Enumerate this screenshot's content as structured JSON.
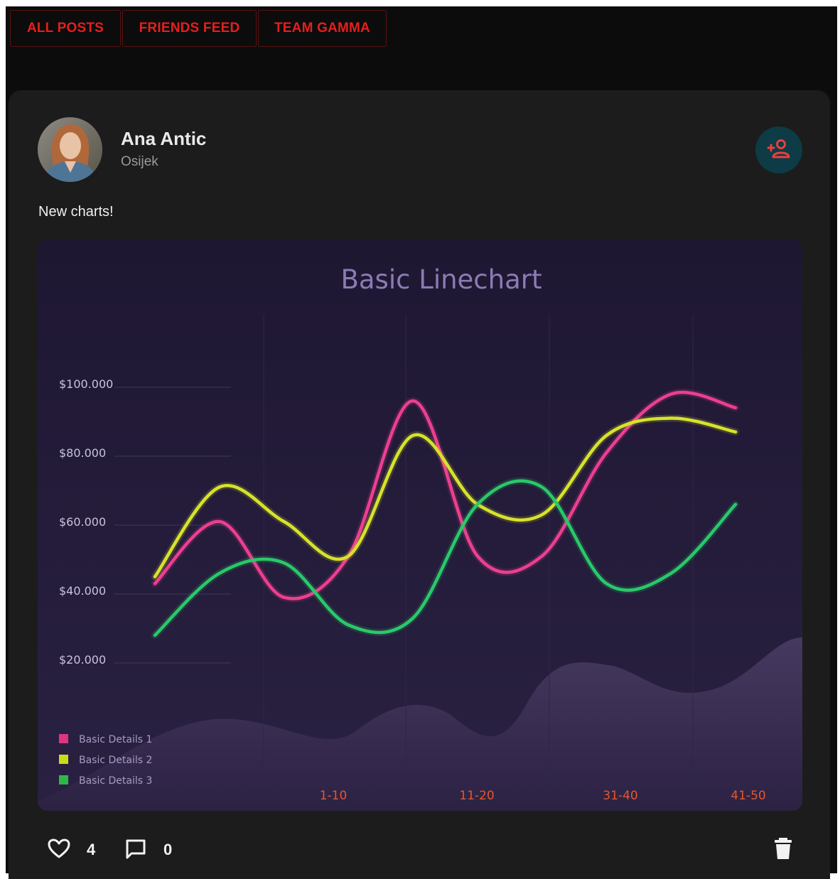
{
  "tabs": [
    "ALL POSTS",
    "FRIENDS FEED",
    "TEAM GAMMA"
  ],
  "post": {
    "author": "Ana Antic",
    "location": "Osijek",
    "text": "New charts!",
    "likes": "4",
    "comments": "0"
  },
  "icons": {
    "follow": "add-user-icon",
    "like": "heart-icon",
    "comment": "comment-icon",
    "delete": "trash-icon"
  },
  "colors": {
    "accent": "#e3201e",
    "follow_bg": "#0d3b46",
    "follow_icon": "#e8403c",
    "card_bg": "#1c1c1c"
  },
  "chart_data": {
    "type": "line",
    "title": "Basic Linechart",
    "categories": [
      "1-10",
      "11-20",
      "31-40",
      "41-50"
    ],
    "yticks": [
      "$100.000",
      "$80.000",
      "$60.000",
      "$40.000",
      "$20.000"
    ],
    "ylim": [
      0,
      120000
    ],
    "x": [
      1,
      2,
      3,
      4,
      5,
      6,
      7,
      8,
      9,
      10
    ],
    "series": [
      {
        "name": "Basic Details 1",
        "color": "#ec3f8f",
        "values": [
          42000,
          60000,
          38000,
          50000,
          95000,
          50000,
          50000,
          80000,
          97000,
          93000
        ]
      },
      {
        "name": "Basic Details 2",
        "color": "#d6e32a",
        "values": [
          44000,
          70000,
          60000,
          50000,
          85000,
          65000,
          62000,
          85000,
          90000,
          86000
        ]
      },
      {
        "name": "Basic Details 3",
        "color": "#29c968",
        "values": [
          27000,
          45000,
          48000,
          30000,
          32000,
          65000,
          70000,
          42000,
          45000,
          65000
        ]
      }
    ],
    "legend": "bottom-left",
    "grid": false
  }
}
